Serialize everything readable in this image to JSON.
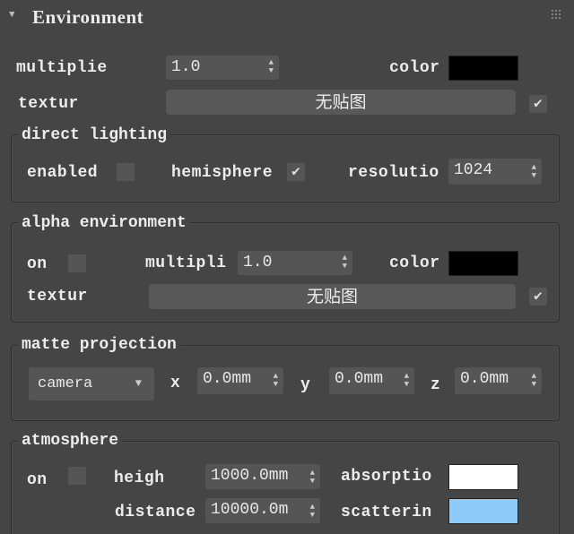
{
  "header": {
    "title": "Environment"
  },
  "main": {
    "multiplier_label": "multiplie",
    "multiplier_value": "1.0",
    "color_label": "color",
    "color": "#000000",
    "texture_label": "textur",
    "texture_button": "无贴图",
    "texture_checked": true
  },
  "direct_lighting": {
    "title": "direct lighting",
    "enabled_label": "enabled",
    "enabled": false,
    "hemisphere_label": "hemisphere",
    "hemisphere": true,
    "resolution_label": "resolutio",
    "resolution_value": "1024"
  },
  "alpha_environment": {
    "title": "alpha environment",
    "on_label": "on",
    "on": false,
    "multiplier_label": "multipli",
    "multiplier_value": "1.0",
    "color_label": "color",
    "color": "#000000",
    "texture_label": "textur",
    "texture_button": "无贴图",
    "texture_checked": true
  },
  "matte_projection": {
    "title": "matte projection",
    "mode": "camera",
    "x_label": "x",
    "x_value": "0.0mm",
    "y_label": "y",
    "y_value": "0.0mm",
    "z_label": "z",
    "z_value": "0.0mm"
  },
  "atmosphere": {
    "title": "atmosphere",
    "on_label": "on",
    "on": false,
    "height_label": "heigh",
    "height_value": "1000.0mm",
    "distance_label": "distance",
    "distance_value": "10000.0m",
    "absorption_label": "absorptio",
    "absorption_color": "#ffffff",
    "scattering_label": "scatterin",
    "scattering_color": "#8ecbfa"
  },
  "icons": {
    "check": "✔",
    "spinner": "▲▼",
    "dropdown": "▼",
    "collapse": "▼"
  }
}
